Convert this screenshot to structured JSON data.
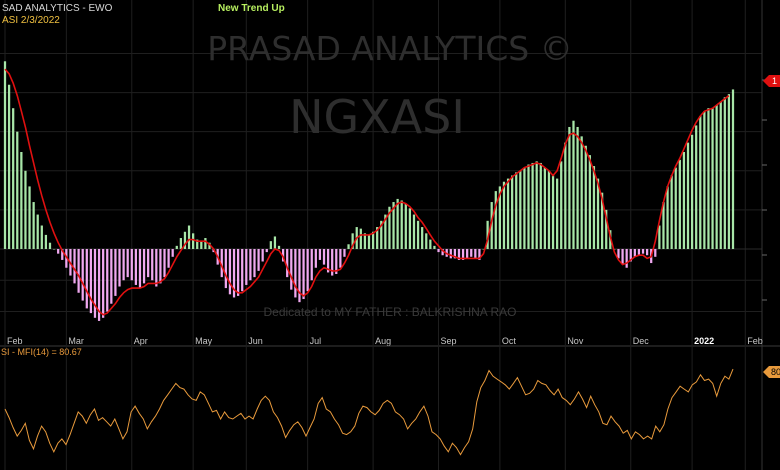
{
  "header": {
    "title": "SAD ANALYTICS - EWO",
    "symbol_date": "ASI  2/3/2022",
    "signal": "New Trend Up"
  },
  "watermark": {
    "line1": "PRASAD ANALYTICS ©",
    "line2": "NGXASI",
    "dedication": "Dedicated to MY FATHER : BALKRISHNA RAO"
  },
  "indicator": {
    "label": "SI - MFI(14) = 80.67",
    "last_tag": "80"
  },
  "price_tag": "1",
  "colors": {
    "background": "#000000",
    "grid": "#1f1f1f",
    "bar_positive": "#a8e6a8",
    "bar_negative": "#f0a8f0",
    "signal_line": "#e01010",
    "mfi_line": "#e89a3c",
    "tick_text": "#c8c8c8",
    "year_tick": "#ffffff",
    "signal_text": "#b8f060",
    "tag_red": "#e01010",
    "tag_orange": "#e89a3c"
  },
  "chart_data": [
    {
      "type": "bar",
      "series": [
        {
          "name": "EWO",
          "values": [
            1.2,
            1.05,
            0.9,
            0.75,
            0.62,
            0.5,
            0.4,
            0.3,
            0.22,
            0.15,
            0.09,
            0.04,
            0.0,
            -0.03,
            -0.07,
            -0.12,
            -0.17,
            -0.22,
            -0.28,
            -0.33,
            -0.38,
            -0.41,
            -0.44,
            -0.46,
            -0.44,
            -0.4,
            -0.35,
            -0.3,
            -0.24,
            -0.2,
            -0.18,
            -0.2,
            -0.23,
            -0.25,
            -0.22,
            -0.18,
            -0.2,
            -0.24,
            -0.22,
            -0.18,
            -0.12,
            -0.05,
            0.02,
            0.07,
            0.11,
            0.15,
            0.1,
            0.06,
            0.05,
            0.07,
            0.04,
            -0.02,
            -0.1,
            -0.18,
            -0.25,
            -0.29,
            -0.31,
            -0.3,
            -0.27,
            -0.23,
            -0.2,
            -0.18,
            -0.14,
            -0.08,
            -0.02,
            0.05,
            0.08,
            0.02,
            -0.08,
            -0.18,
            -0.26,
            -0.31,
            -0.34,
            -0.32,
            -0.27,
            -0.2,
            -0.12,
            -0.07,
            -0.1,
            -0.15,
            -0.17,
            -0.16,
            -0.12,
            -0.05,
            0.03,
            0.1,
            0.14,
            0.13,
            0.1,
            0.09,
            0.11,
            0.14,
            0.18,
            0.22,
            0.27,
            0.3,
            0.32,
            0.31,
            0.29,
            0.26,
            0.22,
            0.18,
            0.14,
            0.1,
            0.06,
            0.02,
            -0.02,
            -0.04,
            -0.05,
            -0.06,
            -0.06,
            -0.07,
            -0.07,
            -0.06,
            -0.05,
            -0.06,
            -0.07,
            0.0,
            0.18,
            0.3,
            0.37,
            0.4,
            0.43,
            0.45,
            0.47,
            0.49,
            0.5,
            0.52,
            0.54,
            0.55,
            0.56,
            0.55,
            0.52,
            0.5,
            0.47,
            0.45,
            0.56,
            0.68,
            0.78,
            0.82,
            0.78,
            0.72,
            0.66,
            0.6,
            0.53,
            0.45,
            0.36,
            0.25,
            0.12,
            0.0,
            -0.06,
            -0.1,
            -0.12,
            -0.08,
            -0.05,
            -0.04,
            -0.03,
            -0.04,
            -0.09,
            -0.05,
            0.15,
            0.3,
            0.4,
            0.47,
            0.52,
            0.57,
            0.62,
            0.68,
            0.73,
            0.79,
            0.85,
            0.88,
            0.9,
            0.9,
            0.92,
            0.94,
            0.97,
            0.99,
            1.02
          ],
          "color": "#a8e6a8",
          "negative_color": "#f0a8f0"
        },
        {
          "name": "Signal",
          "type": "line",
          "values": [
            1.15,
            1.12,
            1.06,
            0.98,
            0.88,
            0.78,
            0.66,
            0.55,
            0.44,
            0.34,
            0.25,
            0.17,
            0.1,
            0.04,
            -0.01,
            -0.05,
            -0.09,
            -0.13,
            -0.17,
            -0.22,
            -0.27,
            -0.32,
            -0.36,
            -0.4,
            -0.42,
            -0.41,
            -0.38,
            -0.35,
            -0.31,
            -0.28,
            -0.26,
            -0.25,
            -0.25,
            -0.25,
            -0.24,
            -0.22,
            -0.22,
            -0.22,
            -0.21,
            -0.19,
            -0.15,
            -0.1,
            -0.05,
            -0.01,
            0.03,
            0.06,
            0.06,
            0.05,
            0.05,
            0.05,
            0.03,
            0.0,
            -0.05,
            -0.11,
            -0.17,
            -0.22,
            -0.26,
            -0.28,
            -0.28,
            -0.26,
            -0.24,
            -0.21,
            -0.18,
            -0.13,
            -0.08,
            -0.03,
            0.0,
            -0.01,
            -0.05,
            -0.12,
            -0.18,
            -0.24,
            -0.28,
            -0.3,
            -0.28,
            -0.24,
            -0.18,
            -0.14,
            -0.12,
            -0.13,
            -0.14,
            -0.14,
            -0.13,
            -0.09,
            -0.04,
            0.02,
            0.07,
            0.09,
            0.09,
            0.09,
            0.1,
            0.12,
            0.15,
            0.19,
            0.23,
            0.26,
            0.29,
            0.3,
            0.29,
            0.27,
            0.24,
            0.2,
            0.17,
            0.13,
            0.09,
            0.05,
            0.02,
            -0.01,
            -0.03,
            -0.04,
            -0.05,
            -0.06,
            -0.06,
            -0.06,
            -0.06,
            -0.06,
            -0.06,
            -0.03,
            0.06,
            0.18,
            0.28,
            0.35,
            0.4,
            0.43,
            0.46,
            0.48,
            0.5,
            0.52,
            0.53,
            0.54,
            0.55,
            0.54,
            0.52,
            0.5,
            0.47,
            0.5,
            0.58,
            0.67,
            0.73,
            0.74,
            0.72,
            0.68,
            0.63,
            0.57,
            0.5,
            0.42,
            0.32,
            0.2,
            0.08,
            -0.02,
            -0.07,
            -0.1,
            -0.09,
            -0.07,
            -0.05,
            -0.04,
            -0.04,
            -0.06,
            -0.05,
            0.05,
            0.18,
            0.3,
            0.4,
            0.47,
            0.53,
            0.58,
            0.64,
            0.7,
            0.76,
            0.81,
            0.85,
            0.88,
            0.89,
            0.9,
            0.92,
            0.94,
            0.96,
            0.98
          ],
          "color": "#e01010"
        }
      ],
      "x_tick_labels": [
        "Feb",
        "Mar",
        "Apr",
        "May",
        "Jun",
        "Jul",
        "Aug",
        "Sep",
        "Oct",
        "Nov",
        "Dec",
        "2022",
        "Feb"
      ],
      "x_tick_index": [
        0,
        15,
        31,
        46,
        59,
        74,
        90,
        106,
        121,
        137,
        153,
        168,
        181
      ],
      "ylim": [
        -0.55,
        1.4
      ],
      "title": "SAD ANALYTICS - EWO",
      "grid": true
    },
    {
      "type": "line",
      "series": [
        {
          "name": "MFI(14)",
          "values": [
            52,
            46,
            39,
            33,
            37,
            42,
            30,
            24,
            33,
            40,
            36,
            28,
            22,
            28,
            31,
            27,
            34,
            42,
            50,
            47,
            42,
            48,
            52,
            44,
            46,
            43,
            40,
            45,
            38,
            31,
            36,
            50,
            54,
            49,
            45,
            38,
            43,
            47,
            52,
            58,
            62,
            66,
            70,
            67,
            66,
            62,
            59,
            58,
            64,
            62,
            56,
            50,
            51,
            45,
            50,
            46,
            45,
            47,
            49,
            45,
            47,
            45,
            52,
            58,
            61,
            58,
            50,
            46,
            40,
            32,
            37,
            41,
            43,
            39,
            33,
            39,
            45,
            56,
            60,
            52,
            50,
            45,
            41,
            35,
            34,
            36,
            40,
            49,
            54,
            53,
            50,
            48,
            51,
            56,
            58,
            56,
            50,
            48,
            45,
            38,
            42,
            45,
            50,
            54,
            47,
            36,
            34,
            31,
            26,
            22,
            28,
            25,
            20,
            25,
            29,
            38,
            57,
            67,
            72,
            79,
            75,
            73,
            71,
            69,
            66,
            70,
            74,
            68,
            62,
            63,
            66,
            72,
            70,
            69,
            65,
            62,
            66,
            60,
            58,
            55,
            59,
            64,
            59,
            53,
            61,
            55,
            50,
            42,
            41,
            47,
            43,
            40,
            35,
            37,
            31,
            36,
            34,
            31,
            33,
            31,
            40,
            36,
            41,
            52,
            60,
            64,
            68,
            66,
            64,
            69,
            71,
            76,
            72,
            73,
            70,
            61,
            70,
            75,
            73,
            80
          ],
          "color": "#e89a3c"
        }
      ],
      "ylim": [
        12,
        92
      ],
      "title": "SI - MFI(14) = 80.67",
      "grid": true
    }
  ]
}
